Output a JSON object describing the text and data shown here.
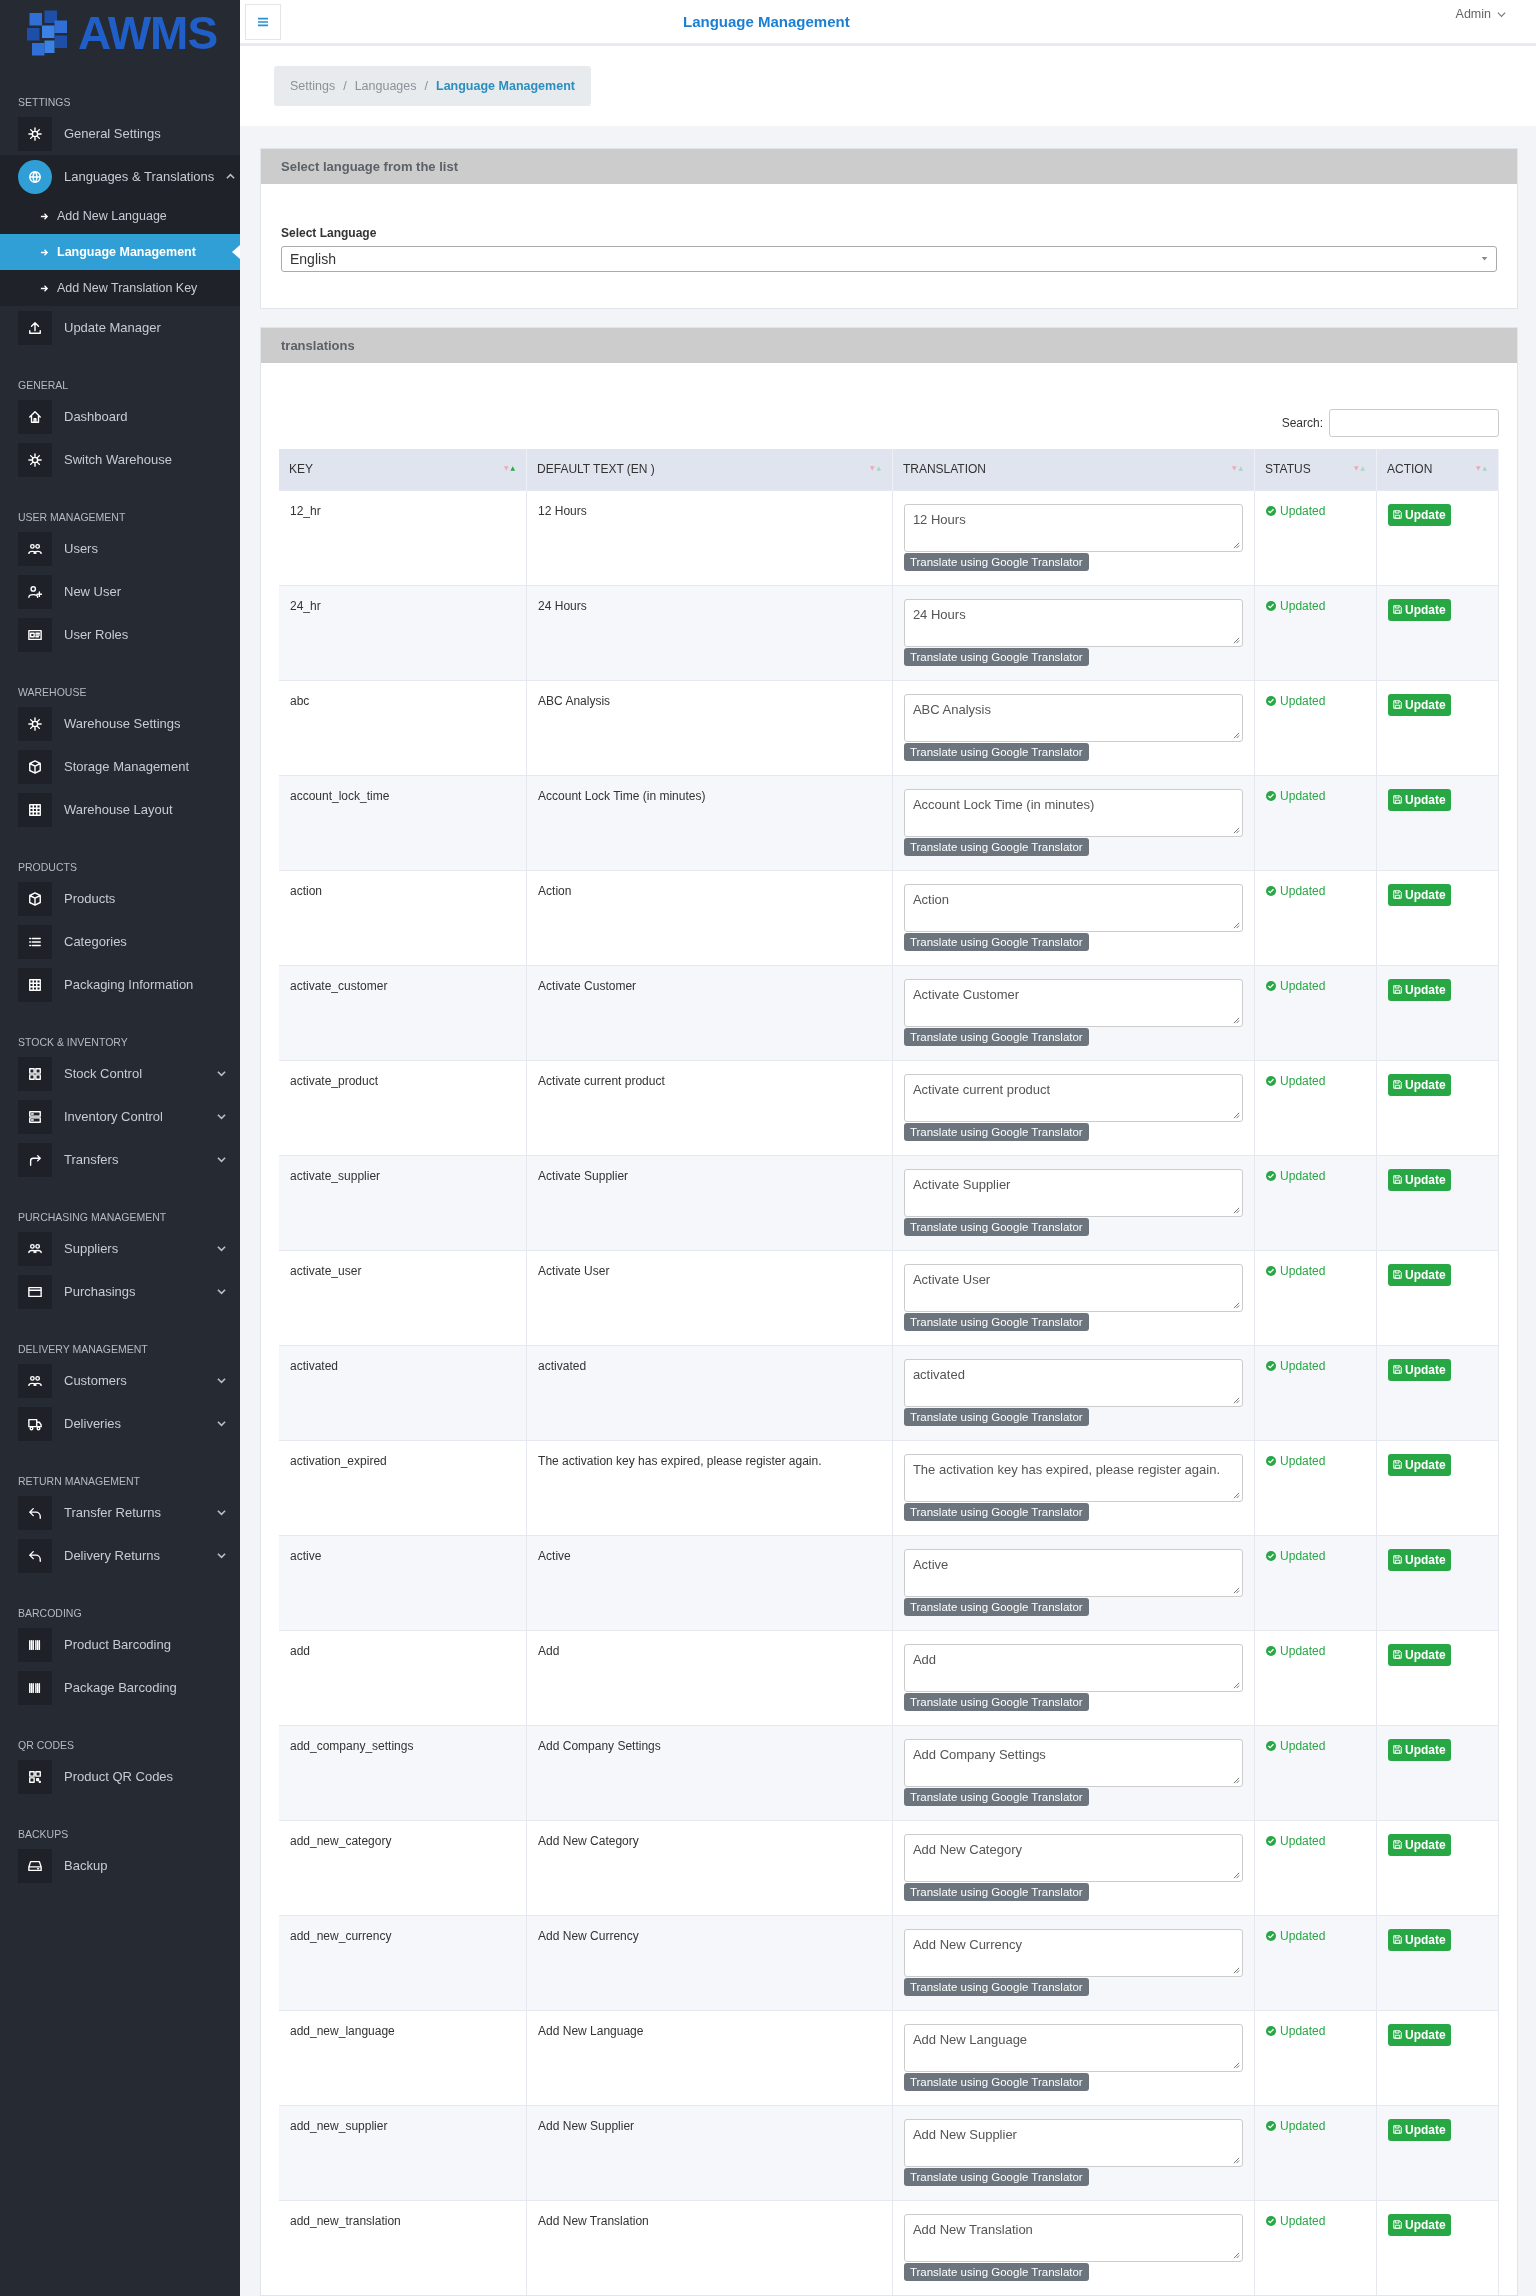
{
  "logo": {
    "text": "AWMS"
  },
  "sidebar": {
    "sections": [
      {
        "title": "SETTINGS",
        "items": [
          {
            "label": "General Settings",
            "kind": "gear",
            "selected": false
          },
          {
            "label": "Languages & Translations",
            "kind": "globe",
            "selected": false,
            "expanded": true,
            "children": [
              {
                "label": "Add New Language",
                "selected": false
              },
              {
                "label": "Language Management",
                "selected": true
              },
              {
                "label": "Add New Translation Key",
                "selected": false
              }
            ]
          },
          {
            "label": "Update Manager",
            "kind": "upload",
            "selected": false
          }
        ]
      },
      {
        "title": "GENERAL",
        "items": [
          {
            "label": "Dashboard",
            "kind": "home",
            "selected": false
          },
          {
            "label": "Switch Warehouse",
            "kind": "gear",
            "selected": false
          }
        ]
      },
      {
        "title": "USER MANAGEMENT",
        "items": [
          {
            "label": "Users",
            "kind": "users",
            "selected": false
          },
          {
            "label": "New User",
            "kind": "userplus",
            "selected": false
          },
          {
            "label": "User Roles",
            "kind": "idcard",
            "selected": false
          }
        ]
      },
      {
        "title": "WAREHOUSE",
        "items": [
          {
            "label": "Warehouse Settings",
            "kind": "gear",
            "selected": false
          },
          {
            "label": "Storage Management",
            "kind": "box",
            "selected": false
          },
          {
            "label": "Warehouse Layout",
            "kind": "grid",
            "selected": false
          }
        ]
      },
      {
        "title": "PRODUCTS",
        "items": [
          {
            "label": "Products",
            "kind": "box",
            "selected": false
          },
          {
            "label": "Categories",
            "kind": "list",
            "selected": false
          },
          {
            "label": "Packaging Information",
            "kind": "grid",
            "selected": false
          }
        ]
      },
      {
        "title": "STOCK & INVENTORY",
        "items": [
          {
            "label": "Stock Control",
            "kind": "squares",
            "selected": false,
            "expanded": false
          },
          {
            "label": "Inventory Control",
            "kind": "server",
            "selected": false,
            "expanded": false
          },
          {
            "label": "Transfers",
            "kind": "share",
            "selected": false,
            "expanded": false
          }
        ]
      },
      {
        "title": "PURCHASING MANAGEMENT",
        "items": [
          {
            "label": "Suppliers",
            "kind": "people",
            "selected": false,
            "expanded": false
          },
          {
            "label": "Purchasings",
            "kind": "card",
            "selected": false,
            "expanded": false
          }
        ]
      },
      {
        "title": "DELIVERY MANAGEMENT",
        "items": [
          {
            "label": "Customers",
            "kind": "users",
            "selected": false,
            "expanded": false
          },
          {
            "label": "Deliveries",
            "kind": "truck",
            "selected": false,
            "expanded": false
          }
        ]
      },
      {
        "title": "RETURN MANAGEMENT",
        "items": [
          {
            "label": "Transfer Returns",
            "kind": "undo",
            "selected": false,
            "expanded": false
          },
          {
            "label": "Delivery Returns",
            "kind": "undo",
            "selected": false,
            "expanded": false
          }
        ]
      },
      {
        "title": "BARCODING",
        "items": [
          {
            "label": "Product Barcoding",
            "kind": "barcode",
            "selected": false
          },
          {
            "label": "Package Barcoding",
            "kind": "barcode",
            "selected": false
          }
        ]
      },
      {
        "title": "QR CODES",
        "items": [
          {
            "label": "Product QR Codes",
            "kind": "qr",
            "selected": false
          }
        ]
      },
      {
        "title": "BACKUPS",
        "items": [
          {
            "label": "Backup",
            "kind": "drive",
            "selected": false
          }
        ]
      }
    ]
  },
  "header": {
    "title": "Language Management",
    "user": "Admin"
  },
  "breadcrumb": {
    "items": [
      {
        "label": "Settings",
        "selected": false
      },
      {
        "label": "Languages",
        "selected": false
      },
      {
        "label": "Language Management",
        "selected": true
      }
    ],
    "separators": [
      "/",
      "/"
    ]
  },
  "language_card": {
    "title": "Select language from the list",
    "label": "Select Language",
    "value": "English"
  },
  "translations_card": {
    "title": "translations",
    "search_label": "Search:",
    "columns": [
      {
        "label": "KEY",
        "sorted": true
      },
      {
        "label": "DEFAULT TEXT (EN )",
        "sorted": false
      },
      {
        "label": "TRANSLATION",
        "sorted": false
      },
      {
        "label": "STATUS",
        "sorted": false
      },
      {
        "label": "ACTION",
        "sorted": false
      }
    ],
    "rows": [
      {
        "key": "12_hr",
        "default": "12 Hours",
        "translation": "12 Hours",
        "translate_button": "Translate using Google Translator",
        "status": "Updated",
        "action": "Update"
      },
      {
        "key": "24_hr",
        "default": "24 Hours",
        "translation": "24 Hours",
        "translate_button": "Translate using Google Translator",
        "status": "Updated",
        "action": "Update"
      },
      {
        "key": "abc",
        "default": "ABC Analysis",
        "translation": "ABC Analysis",
        "translate_button": "Translate using Google Translator",
        "status": "Updated",
        "action": "Update"
      },
      {
        "key": "account_lock_time",
        "default": "Account Lock Time (in minutes)",
        "translation": "Account Lock Time (in minutes)",
        "translate_button": "Translate using Google Translator",
        "status": "Updated",
        "action": "Update"
      },
      {
        "key": "action",
        "default": "Action",
        "translation": "Action",
        "translate_button": "Translate using Google Translator",
        "status": "Updated",
        "action": "Update"
      },
      {
        "key": "activate_customer",
        "default": "Activate Customer",
        "translation": "Activate Customer",
        "translate_button": "Translate using Google Translator",
        "status": "Updated",
        "action": "Update"
      },
      {
        "key": "activate_product",
        "default": "Activate current product",
        "translation": "Activate current product",
        "translate_button": "Translate using Google Translator",
        "status": "Updated",
        "action": "Update"
      },
      {
        "key": "activate_supplier",
        "default": "Activate Supplier",
        "translation": "Activate Supplier",
        "translate_button": "Translate using Google Translator",
        "status": "Updated",
        "action": "Update"
      },
      {
        "key": "activate_user",
        "default": "Activate User",
        "translation": "Activate User",
        "translate_button": "Translate using Google Translator",
        "status": "Updated",
        "action": "Update"
      },
      {
        "key": "activated",
        "default": "activated",
        "translation": "activated",
        "translate_button": "Translate using Google Translator",
        "status": "Updated",
        "action": "Update"
      },
      {
        "key": "activation_expired",
        "default": "The activation key has expired, please register again.",
        "translation": "The activation key has expired, please register again.",
        "translate_button": "Translate using Google Translator",
        "status": "Updated",
        "action": "Update"
      },
      {
        "key": "active",
        "default": "Active",
        "translation": "Active",
        "translate_button": "Translate using Google Translator",
        "status": "Updated",
        "action": "Update"
      },
      {
        "key": "add",
        "default": "Add",
        "translation": "Add",
        "translate_button": "Translate using Google Translator",
        "status": "Updated",
        "action": "Update"
      },
      {
        "key": "add_company_settings",
        "default": "Add Company Settings",
        "translation": "Add Company Settings",
        "translate_button": "Translate using Google Translator",
        "status": "Updated",
        "action": "Update"
      },
      {
        "key": "add_new_category",
        "default": "Add New Category",
        "translation": "Add New Category",
        "translate_button": "Translate using Google Translator",
        "status": "Updated",
        "action": "Update"
      },
      {
        "key": "add_new_currency",
        "default": "Add New Currency",
        "translation": "Add New Currency",
        "translate_button": "Translate using Google Translator",
        "status": "Updated",
        "action": "Update"
      },
      {
        "key": "add_new_language",
        "default": "Add New Language",
        "translation": "Add New Language",
        "translate_button": "Translate using Google Translator",
        "status": "Updated",
        "action": "Update"
      },
      {
        "key": "add_new_supplier",
        "default": "Add New Supplier",
        "translation": "Add New Supplier",
        "translate_button": "Translate using Google Translator",
        "status": "Updated",
        "action": "Update"
      },
      {
        "key": "add_new_translation",
        "default": "Add New Translation",
        "translation": "Add New Translation",
        "translate_button": "Translate using Google Translator",
        "status": "Updated",
        "action": "Update"
      }
    ]
  }
}
